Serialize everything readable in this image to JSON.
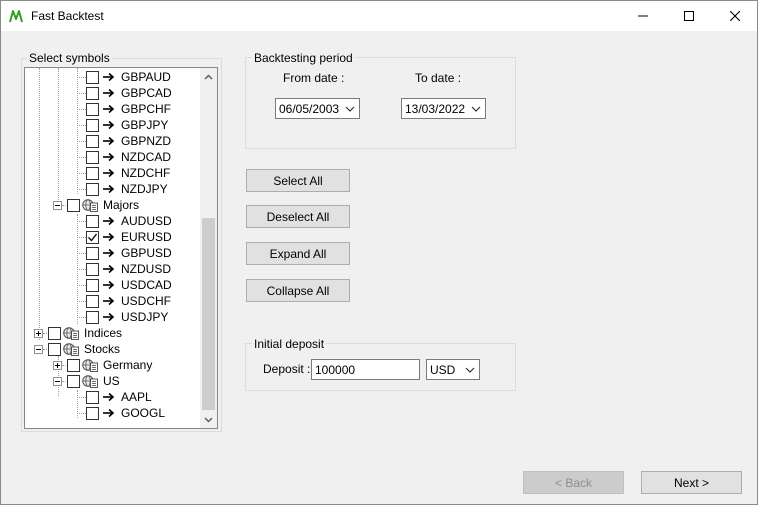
{
  "window": {
    "title": "Fast Backtest",
    "controls": {
      "minimize": "minimize",
      "maximize": "maximize",
      "close": "close"
    }
  },
  "symbols": {
    "group_label": "Select symbols",
    "rows": [
      {
        "label": "GBPAUD",
        "level": 3,
        "type": "leaf",
        "checked": false
      },
      {
        "label": "GBPCAD",
        "level": 3,
        "type": "leaf",
        "checked": false
      },
      {
        "label": "GBPCHF",
        "level": 3,
        "type": "leaf",
        "checked": false
      },
      {
        "label": "GBPJPY",
        "level": 3,
        "type": "leaf",
        "checked": false
      },
      {
        "label": "GBPNZD",
        "level": 3,
        "type": "leaf",
        "checked": false
      },
      {
        "label": "NZDCAD",
        "level": 3,
        "type": "leaf",
        "checked": false
      },
      {
        "label": "NZDCHF",
        "level": 3,
        "type": "leaf",
        "checked": false
      },
      {
        "label": "NZDJPY",
        "level": 3,
        "type": "leaf",
        "checked": false
      },
      {
        "label": "Majors",
        "level": 2,
        "type": "folder",
        "expanded": true,
        "checked": false
      },
      {
        "label": "AUDUSD",
        "level": 3,
        "type": "leaf",
        "checked": false
      },
      {
        "label": "EURUSD",
        "level": 3,
        "type": "leaf",
        "checked": true
      },
      {
        "label": "GBPUSD",
        "level": 3,
        "type": "leaf",
        "checked": false
      },
      {
        "label": "NZDUSD",
        "level": 3,
        "type": "leaf",
        "checked": false
      },
      {
        "label": "USDCAD",
        "level": 3,
        "type": "leaf",
        "checked": false
      },
      {
        "label": "USDCHF",
        "level": 3,
        "type": "leaf",
        "checked": false
      },
      {
        "label": "USDJPY",
        "level": 3,
        "type": "leaf",
        "checked": false
      },
      {
        "label": "Indices",
        "level": 1,
        "type": "folder",
        "expanded": false,
        "checked": false
      },
      {
        "label": "Stocks",
        "level": 1,
        "type": "folder",
        "expanded": true,
        "checked": false
      },
      {
        "label": "Germany",
        "level": 2,
        "type": "folder",
        "expanded": false,
        "checked": false
      },
      {
        "label": "US",
        "level": 2,
        "type": "folder",
        "expanded": true,
        "checked": false
      },
      {
        "label": "AAPL",
        "level": 3,
        "type": "leaf",
        "checked": false
      },
      {
        "label": "GOOGL",
        "level": 3,
        "type": "leaf",
        "checked": false
      }
    ]
  },
  "period": {
    "group_label": "Backtesting period",
    "from_label": "From date :",
    "to_label": "To date :",
    "from_value": "06/05/2003",
    "to_value": "13/03/2022"
  },
  "actions": {
    "select_all": "Select All",
    "deselect_all": "Deselect All",
    "expand_all": "Expand All",
    "collapse_all": "Collapse All"
  },
  "deposit": {
    "group_label": "Initial deposit",
    "label": "Deposit :",
    "value": "100000",
    "currency": "USD"
  },
  "nav": {
    "back": "< Back",
    "next": "Next >"
  },
  "colors": {
    "app_icon": "#3a9a2a",
    "checkmark": "#000000",
    "scroll_thumb": "#cdcdcd"
  }
}
